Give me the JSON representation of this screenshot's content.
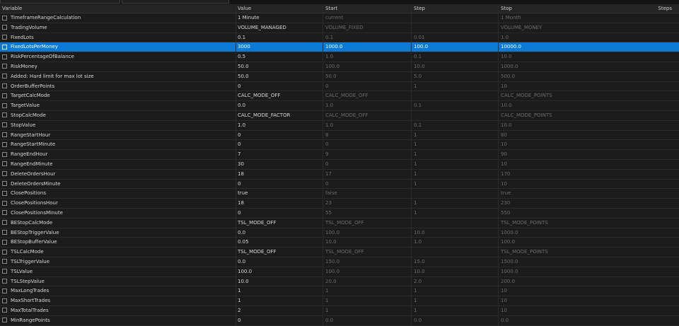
{
  "header": {
    "variable": "Variable",
    "value": "Value",
    "start": "Start",
    "step": "Step",
    "stop": "Stop",
    "steps": "Steps"
  },
  "selected_index": 3,
  "rows": [
    {
      "name": "TimeframeRangeCalculation",
      "value": "1 Minute",
      "start": "current",
      "step": "",
      "stop": "1 Month"
    },
    {
      "name": "TradingVolume",
      "value": "VOLUME_MANAGED",
      "start": "VOLUME_FIXED",
      "step": "",
      "stop": "VOLUME_MONEY"
    },
    {
      "name": "FixedLots",
      "value": "0.1",
      "start": "0.1",
      "step": "0.01",
      "stop": "1.0"
    },
    {
      "name": "FixedLotsPerMoney",
      "value": "3000",
      "start": "1000.0",
      "step": "100.0",
      "stop": "10000.0"
    },
    {
      "name": "RiskPercentageOfBalance",
      "value": "0.5",
      "start": "1.0",
      "step": "0.1",
      "stop": "10.0"
    },
    {
      "name": "RiskMoney",
      "value": "50.0",
      "start": "100.0",
      "step": "10.0",
      "stop": "1000.0"
    },
    {
      "name": "Added: Hard limit for max lot size",
      "value": "50.0",
      "start": "50.0",
      "step": "5.0",
      "stop": "500.0"
    },
    {
      "name": "OrderBufferPoints",
      "value": "0",
      "start": "0",
      "step": "1",
      "stop": "10"
    },
    {
      "name": "TargetCalcMode",
      "value": "CALC_MODE_OFF",
      "start": "CALC_MODE_OFF",
      "step": "",
      "stop": "CALC_MODE_POINTS"
    },
    {
      "name": "TargetValue",
      "value": "0.0",
      "start": "1.0",
      "step": "0.1",
      "stop": "10.0"
    },
    {
      "name": "StopCalcMode",
      "value": "CALC_MODE_FACTOR",
      "start": "CALC_MODE_OFF",
      "step": "",
      "stop": "CALC_MODE_POINTS"
    },
    {
      "name": "StopValue",
      "value": "1.0",
      "start": "1.0",
      "step": "0.1",
      "stop": "10.0"
    },
    {
      "name": "RangeStartHour",
      "value": "0",
      "start": "8",
      "step": "1",
      "stop": "80"
    },
    {
      "name": "RangeStartMinute",
      "value": "0",
      "start": "0",
      "step": "1",
      "stop": "10"
    },
    {
      "name": "RangeEndHour",
      "value": "7",
      "start": "9",
      "step": "1",
      "stop": "90"
    },
    {
      "name": "RangeEndMinute",
      "value": "30",
      "start": "0",
      "step": "1",
      "stop": "10"
    },
    {
      "name": "DeleteOrdersHour",
      "value": "18",
      "start": "17",
      "step": "1",
      "stop": "170"
    },
    {
      "name": "DeleteOrdersMinute",
      "value": "0",
      "start": "0",
      "step": "1",
      "stop": "10"
    },
    {
      "name": "ClosePositions",
      "value": "true",
      "start": "false",
      "step": "",
      "stop": "true"
    },
    {
      "name": "ClosePositionsHour",
      "value": "18",
      "start": "23",
      "step": "1",
      "stop": "230"
    },
    {
      "name": "ClosePositionsMinute",
      "value": "0",
      "start": "55",
      "step": "1",
      "stop": "550"
    },
    {
      "name": "BEStopCalcMode",
      "value": "TSL_MODE_OFF",
      "start": "TSL_MODE_OFF",
      "step": "",
      "stop": "TSL_MODE_POINTS"
    },
    {
      "name": "BEStopTriggerValue",
      "value": "0.0",
      "start": "100.0",
      "step": "10.0",
      "stop": "1000.0"
    },
    {
      "name": "BEStopBufferValue",
      "value": "0.05",
      "start": "10.0",
      "step": "1.0",
      "stop": "100.0"
    },
    {
      "name": "TSLCalcMode",
      "value": "TSL_MODE_OFF",
      "start": "TSL_MODE_OFF",
      "step": "",
      "stop": "TSL_MODE_POINTS"
    },
    {
      "name": "TSLTriggerValue",
      "value": "0.0",
      "start": "150.0",
      "step": "15.0",
      "stop": "1500.0"
    },
    {
      "name": "TSLValue",
      "value": "100.0",
      "start": "100.0",
      "step": "10.0",
      "stop": "1000.0"
    },
    {
      "name": "TSLStepValue",
      "value": "10.0",
      "start": "20.0",
      "step": "2.0",
      "stop": "200.0"
    },
    {
      "name": "MaxLongTrades",
      "value": "1",
      "start": "1",
      "step": "1",
      "stop": "10"
    },
    {
      "name": "MaxShortTrades",
      "value": "1",
      "start": "1",
      "step": "1",
      "stop": "10"
    },
    {
      "name": "MaxTotalTrades",
      "value": "2",
      "start": "1",
      "step": "1",
      "stop": "10"
    },
    {
      "name": "MinRangePoints",
      "value": "0",
      "start": "0.0",
      "step": "0.0",
      "stop": "0.0"
    }
  ]
}
